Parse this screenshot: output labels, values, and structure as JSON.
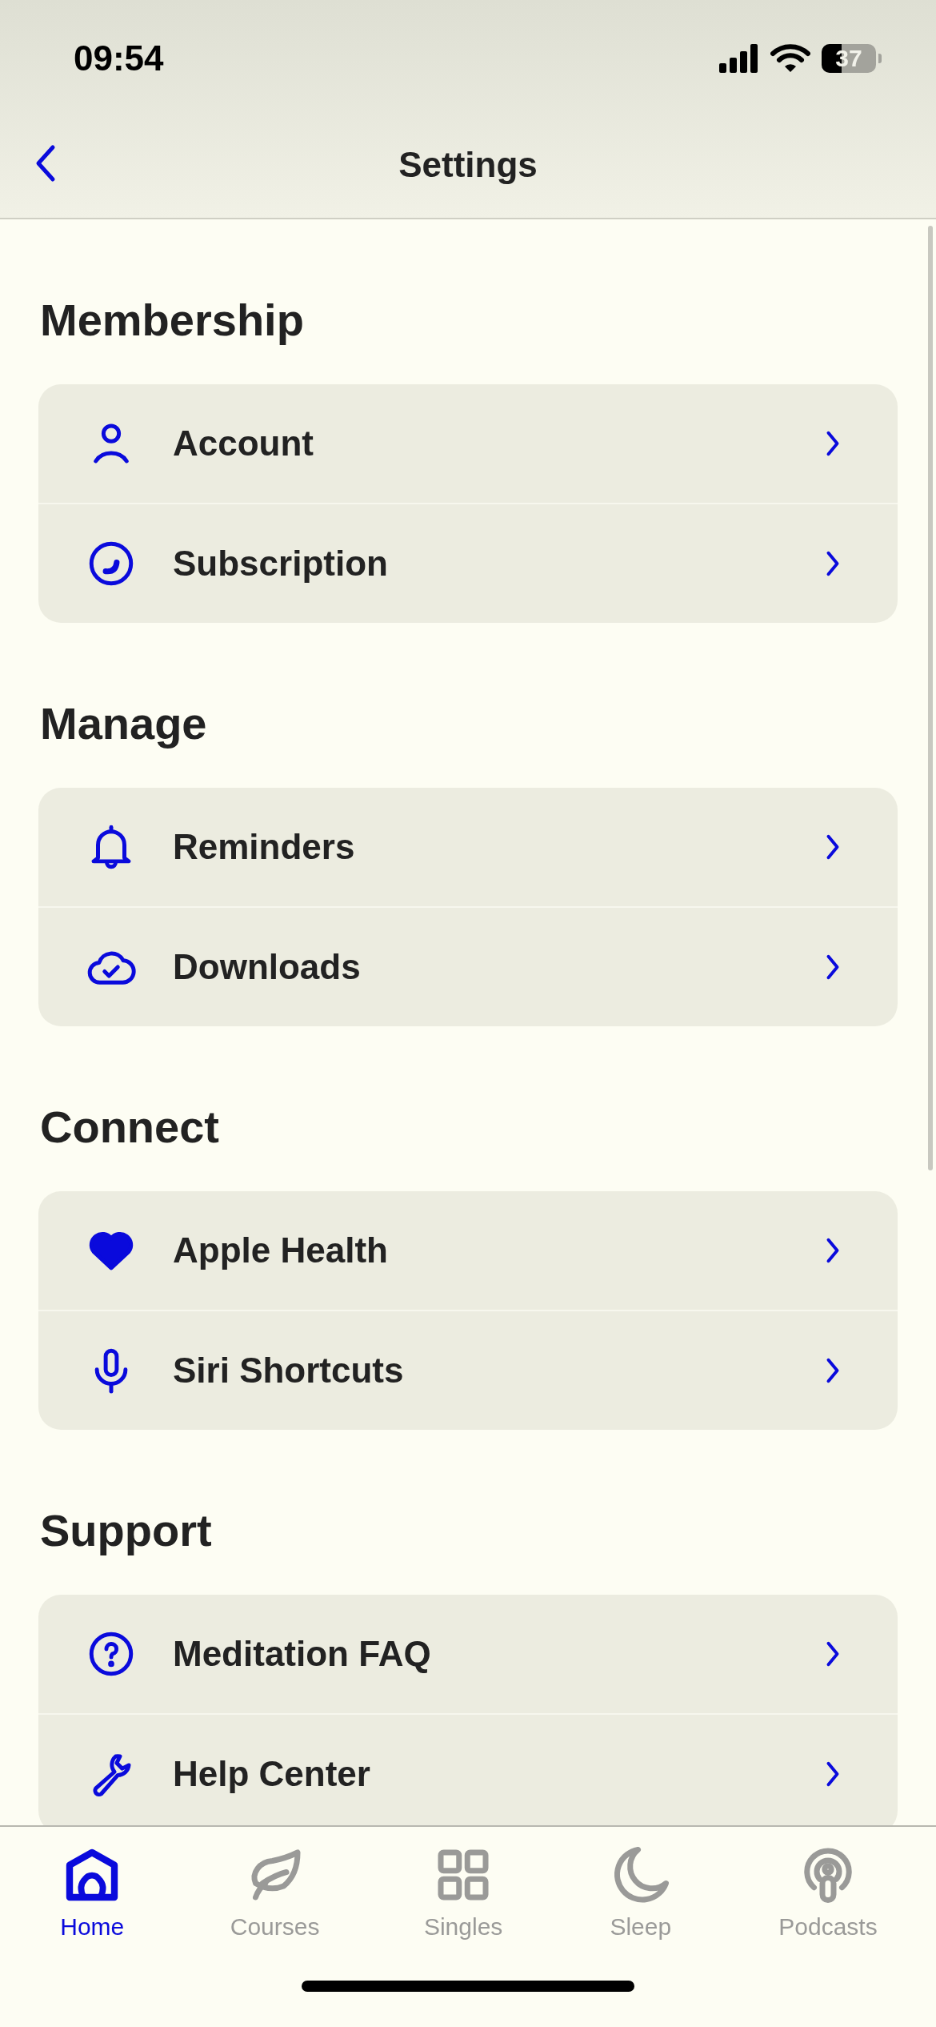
{
  "status_bar": {
    "time": "09:54",
    "battery": "37"
  },
  "nav": {
    "title": "Settings"
  },
  "sections": [
    {
      "title": "Membership",
      "items": [
        {
          "label": "Account"
        },
        {
          "label": "Subscription"
        }
      ]
    },
    {
      "title": "Manage",
      "items": [
        {
          "label": "Reminders"
        },
        {
          "label": "Downloads"
        }
      ]
    },
    {
      "title": "Connect",
      "items": [
        {
          "label": "Apple Health"
        },
        {
          "label": "Siri Shortcuts"
        }
      ]
    },
    {
      "title": "Support",
      "items": [
        {
          "label": "Meditation FAQ"
        },
        {
          "label": "Help Center"
        }
      ]
    }
  ],
  "tabs": [
    {
      "label": "Home",
      "selected": true
    },
    {
      "label": "Courses",
      "selected": false
    },
    {
      "label": "Singles",
      "selected": false
    },
    {
      "label": "Sleep",
      "selected": false
    },
    {
      "label": "Podcasts",
      "selected": false
    }
  ]
}
